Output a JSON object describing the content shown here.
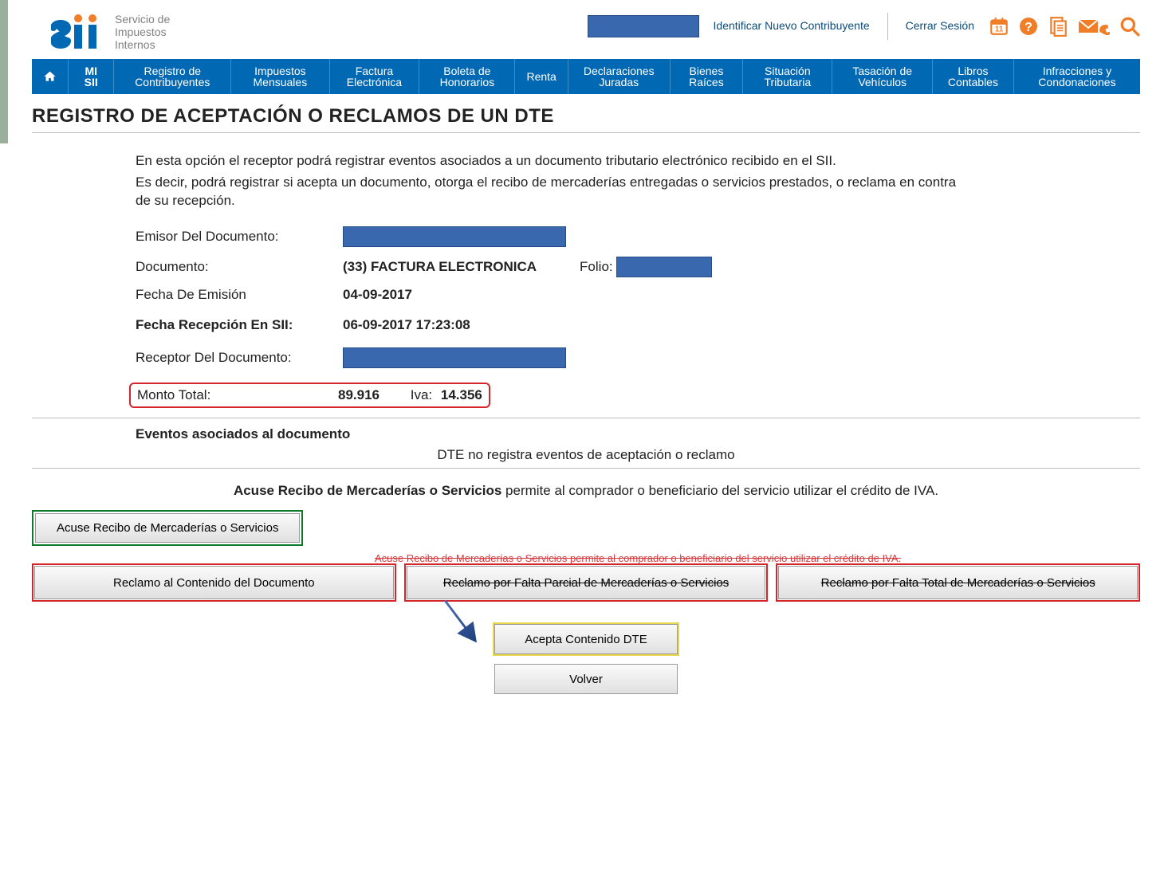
{
  "header": {
    "logo_tag1": "Servicio de",
    "logo_tag2": "Impuestos",
    "logo_tag3": "Internos",
    "link_identify": "Identificar Nuevo Contribuyente",
    "link_close": "Cerrar Sesión"
  },
  "nav": {
    "misii": "MI SII",
    "items": [
      "Registro de Contribuyentes",
      "Impuestos Mensuales",
      "Factura Electrónica",
      "Boleta de Honorarios",
      "Renta",
      "Declaraciones Juradas",
      "Bienes Raíces",
      "Situación Tributaria",
      "Tasación de Vehículos",
      "Libros Contables",
      "Infracciones y Condonaciones"
    ]
  },
  "page_title": "REGISTRO DE ACEPTACIÓN O RECLAMOS DE UN DTE",
  "intro": {
    "p1": "En esta opción el receptor podrá registrar eventos asociados a un documento tributario electrónico recibido en el SII.",
    "p2": "Es decir, podrá registrar si acepta un documento, otorga el recibo de mercaderías entregadas o servicios prestados, o reclama en contra de su recepción."
  },
  "labels": {
    "emisor": "Emisor Del Documento:",
    "documento": "Documento:",
    "folio": "Folio:",
    "fecha_emision": "Fecha De Emisión",
    "fecha_recepcion": "Fecha Recepción En SII:",
    "receptor": "Receptor Del Documento:",
    "monto_total": "Monto Total:",
    "iva": "Iva:"
  },
  "values": {
    "documento": "(33) FACTURA ELECTRONICA",
    "fecha_emision": "04-09-2017",
    "fecha_recepcion": "06-09-2017 17:23:08",
    "monto_total": "89.916",
    "iva": "14.356"
  },
  "events": {
    "title": "Eventos asociados al documento",
    "msg": "DTE no registra eventos de aceptación o reclamo"
  },
  "acuse": {
    "bold": "Acuse Recibo de Mercaderías o Servicios",
    "rest": " permite al comprador o beneficiario del servicio utilizar el crédito de IVA."
  },
  "buttons": {
    "acuse_recibo": "Acuse Recibo de Mercaderías o Servicios",
    "reclamo_contenido": "Reclamo al Contenido del Documento",
    "reclamo_parcial": "Reclamo por Falta Parcial de Mercaderías o Servicios",
    "reclamo_total": "Reclamo por Falta Total de Mercaderías o Servicios",
    "ghost_text": "Acuse Recibo de Mercaderías o Servicios permite al comprador o beneficiario del servicio utilizar el crédito de IVA.",
    "acepta": "Acepta Contenido DTE",
    "volver": "Volver"
  }
}
